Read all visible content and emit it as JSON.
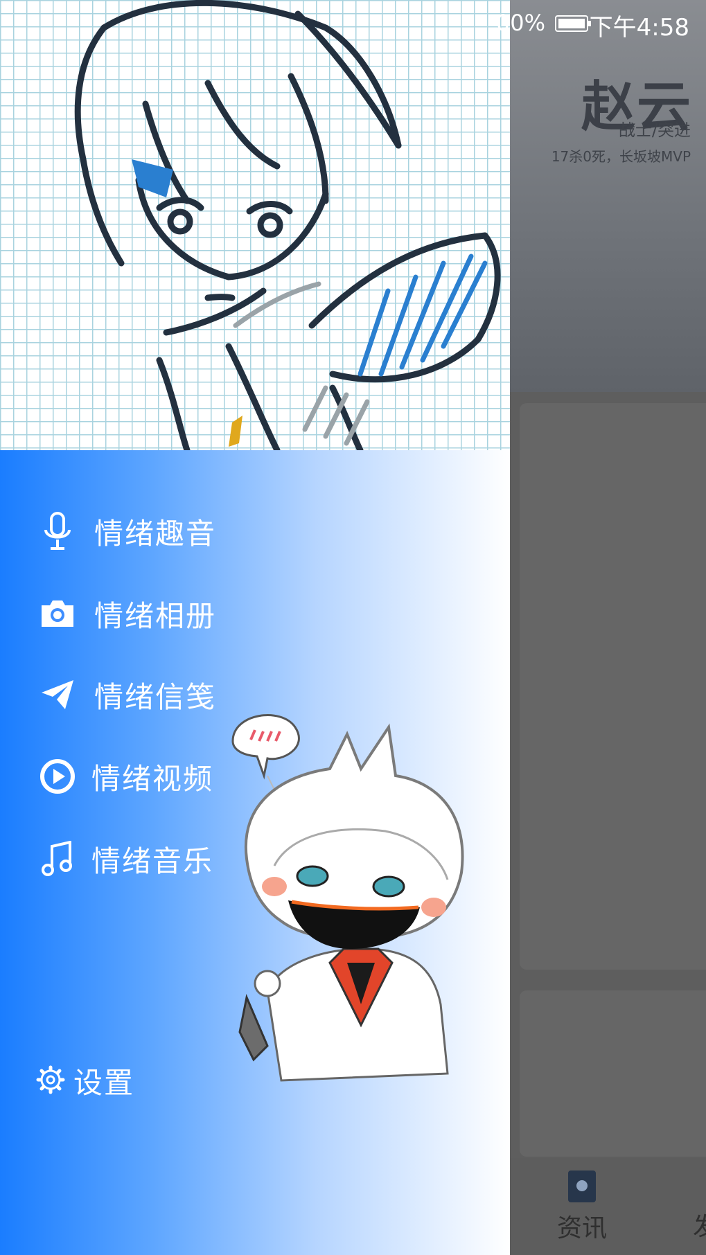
{
  "status_bar": {
    "left_text": "",
    "battery_percent": "00%",
    "time": "下午4:58"
  },
  "drawer": {
    "menu": [
      {
        "label": "情绪趣音",
        "icon": "microphone-icon"
      },
      {
        "label": "情绪相册",
        "icon": "camera-icon"
      },
      {
        "label": "情绪信笺",
        "icon": "paper-plane-icon"
      },
      {
        "label": "情绪视频",
        "icon": "play-circle-icon"
      },
      {
        "label": "情绪音乐",
        "icon": "music-note-icon"
      }
    ],
    "settings_label": "设置",
    "colors": {
      "gradient_start": "#1a7dff",
      "gradient_end": "#ffffff"
    }
  },
  "background_app": {
    "banner": {
      "hero_name": "赵云",
      "hero_role": "战士/突进",
      "hero_desc": "17杀0死，长坂坡MVP"
    },
    "tabs": {
      "news_label": "资讯",
      "discover_label": "发"
    }
  }
}
